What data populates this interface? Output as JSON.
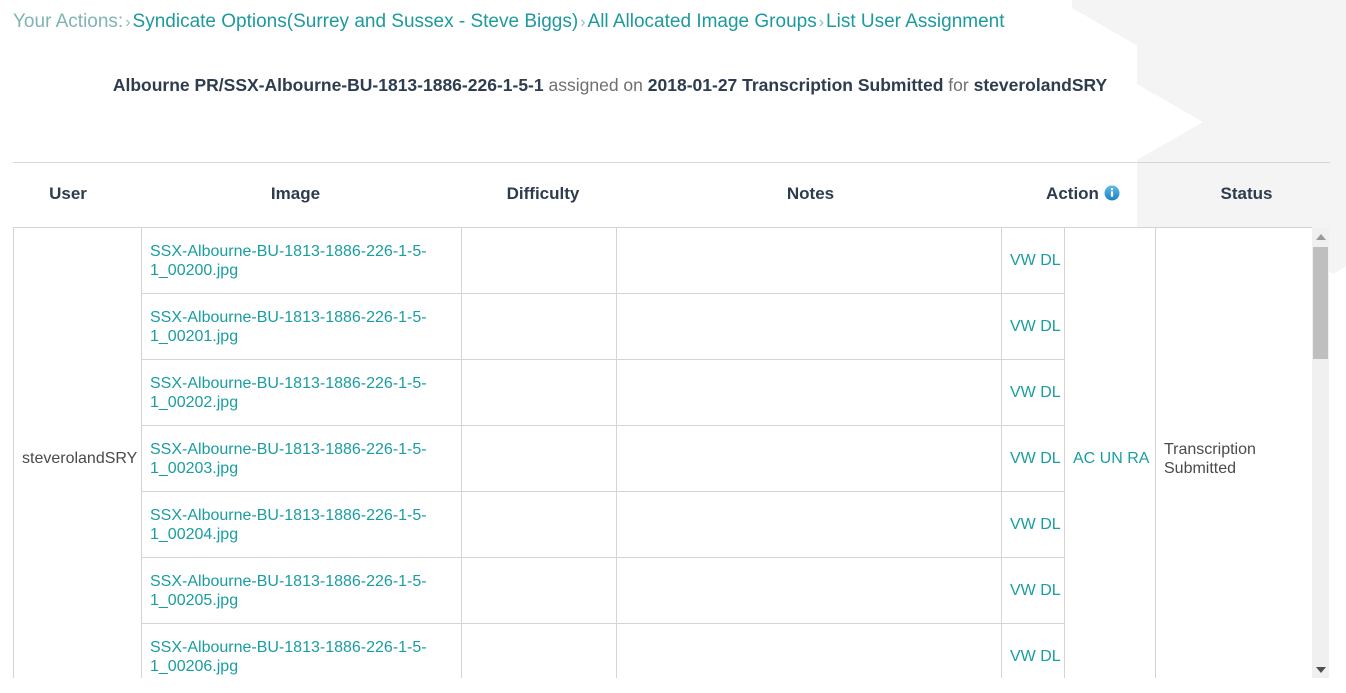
{
  "breadcrumb": {
    "root_label": "Your Actions:",
    "separator": "›",
    "items": [
      {
        "label": "Syndicate Options(Surrey and Sussex - Steve Biggs)"
      },
      {
        "label": "All Allocated Image Groups"
      },
      {
        "label": "List User Assignment"
      }
    ]
  },
  "title": {
    "group_name": "Albourne PR/SSX-Albourne-BU-1813-1886-226-1-5-1",
    "mid_text": "assigned on",
    "assigned_date_status": "2018-01-27 Transcription Submitted",
    "for_text": "for",
    "user": "steverolandSRY"
  },
  "table": {
    "columns": [
      {
        "key": "user",
        "label": "User"
      },
      {
        "key": "image",
        "label": "Image"
      },
      {
        "key": "difficulty",
        "label": "Difficulty"
      },
      {
        "key": "notes",
        "label": "Notes"
      },
      {
        "key": "action",
        "label": "Action",
        "icon": "info-icon"
      },
      {
        "key": "status",
        "label": "Status"
      }
    ],
    "user_cell": "steverolandSRY",
    "group_actions": "AC UN RA",
    "group_action_links": [
      "AC",
      "UN",
      "RA"
    ],
    "status_cell": "Transcription Submitted",
    "row_action_label": "VW DL",
    "row_action_links": [
      "VW",
      "DL"
    ],
    "rows": [
      {
        "image": "SSX-Albourne-BU-1813-1886-226-1-5-1_00200.jpg",
        "difficulty": "",
        "notes": "",
        "action": "VW DL"
      },
      {
        "image": "SSX-Albourne-BU-1813-1886-226-1-5-1_00201.jpg",
        "difficulty": "",
        "notes": "",
        "action": "VW DL"
      },
      {
        "image": "SSX-Albourne-BU-1813-1886-226-1-5-1_00202.jpg",
        "difficulty": "",
        "notes": "",
        "action": "VW DL"
      },
      {
        "image": "SSX-Albourne-BU-1813-1886-226-1-5-1_00203.jpg",
        "difficulty": "",
        "notes": "",
        "action": "VW DL"
      },
      {
        "image": "SSX-Albourne-BU-1813-1886-226-1-5-1_00204.jpg",
        "difficulty": "",
        "notes": "",
        "action": "VW DL"
      },
      {
        "image": "SSX-Albourne-BU-1813-1886-226-1-5-1_00205.jpg",
        "difficulty": "",
        "notes": "",
        "action": "VW DL"
      },
      {
        "image": "SSX-Albourne-BU-1813-1886-226-1-5-1_00206.jpg",
        "difficulty": "",
        "notes": "",
        "action": "VW DL"
      }
    ]
  },
  "scrollbar": {
    "up_icon": "triangle-up-icon",
    "down_icon": "triangle-down-icon"
  },
  "colors": {
    "link_teal": "#1a9da1",
    "breadcrumb_root": "#7fb3b5",
    "title_dark": "#2e3c4f",
    "title_muted": "#6d6f71",
    "info_blue": "#3aa0d8",
    "border": "#d4d4d4",
    "watermark": "#f4f4f4"
  }
}
